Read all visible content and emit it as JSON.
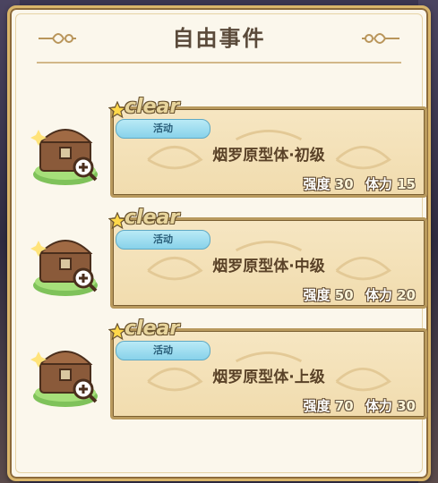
{
  "panel": {
    "title": "自由事件"
  },
  "events": [
    {
      "status": "clear",
      "badge": "活动",
      "name": "烟罗原型体·初级",
      "strength_label": "强度",
      "strength": "30",
      "stamina_label": "体力",
      "stamina": "15"
    },
    {
      "status": "clear",
      "badge": "活动",
      "name": "烟罗原型体·中级",
      "strength_label": "强度",
      "strength": "50",
      "stamina_label": "体力",
      "stamina": "20"
    },
    {
      "status": "clear",
      "badge": "活动",
      "name": "烟罗原型体·上级",
      "strength_label": "强度",
      "strength": "70",
      "stamina_label": "体力",
      "stamina": "30"
    }
  ],
  "icons": {
    "chest": "treasure-chest-icon",
    "star": "star-icon",
    "ornament": "flourish-ornament-icon"
  },
  "colors": {
    "panel_bg": "#fbf7ec",
    "card_bg": "#f1dcae",
    "badge_bg": "#88d2ea",
    "title_text": "#5a4a3a"
  }
}
